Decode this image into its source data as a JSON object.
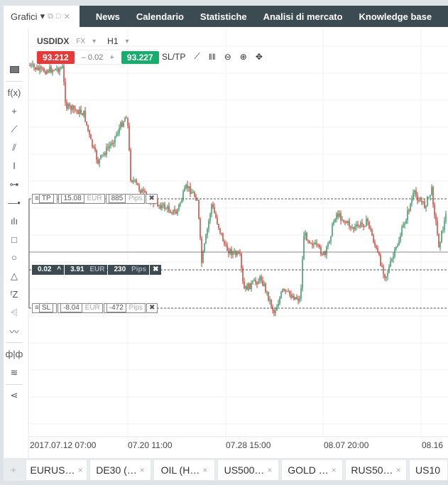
{
  "top_tab": {
    "label": "Grafici"
  },
  "nav": [
    "News",
    "Calendario",
    "Statistiche",
    "Analisi di mercato",
    "Knowledge base"
  ],
  "symbol": {
    "name": "USDIDX",
    "type": "FX",
    "timeframe": "H1"
  },
  "quote": {
    "sell": "93.212",
    "spread": "0.02",
    "buy": "93.227",
    "sltp": "SL/TP"
  },
  "tp": {
    "label": "TP",
    "profit": "15.08",
    "cur": "EUR",
    "pips": "885",
    "pips_label": "Pips"
  },
  "position": {
    "volume": "0.02",
    "profit": "3.91",
    "cur": "EUR",
    "pips": "230",
    "pips_label": "Pips"
  },
  "sl": {
    "label": "SL",
    "profit": "-8.04",
    "cur": "EUR",
    "pips": "-472",
    "pips_label": "Pips"
  },
  "left_toolbar": [
    "f(x)"
  ],
  "dates": [
    "2017.07.12 07:00",
    "07.20 11:00",
    "07.28 15:00",
    "08.07 20:00",
    "08.16"
  ],
  "bottom_tabs": [
    "EURUS…",
    "DE30 (…",
    "OIL (H…",
    "US500…",
    "GOLD …",
    "RUS50…",
    "US10"
  ],
  "colors": {
    "up": "#2e8b57",
    "down": "#c0392b",
    "nav": "#3c4a52"
  }
}
